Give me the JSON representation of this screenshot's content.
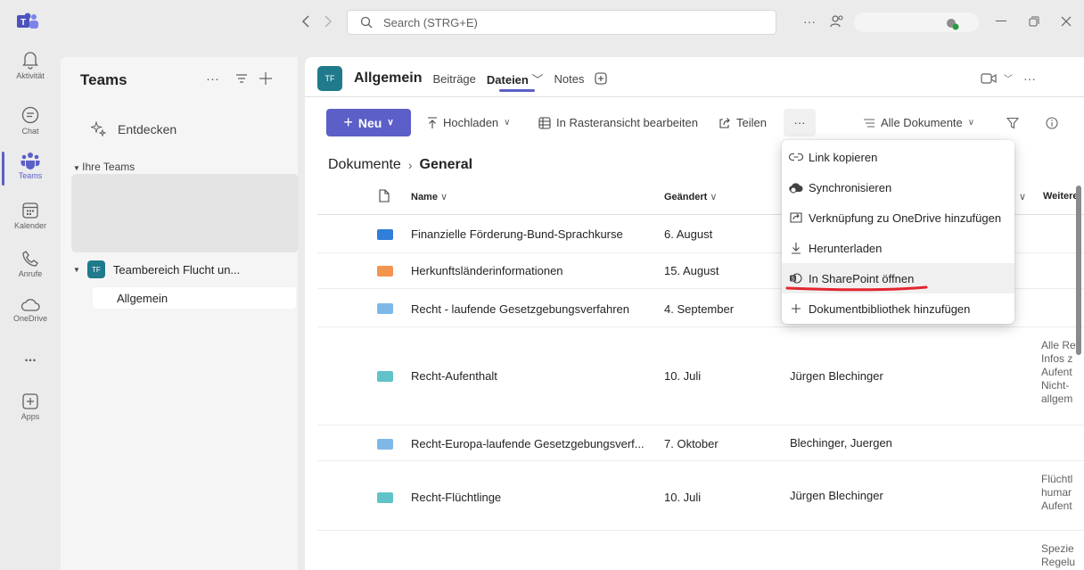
{
  "titlebar": {
    "search_placeholder": "Search (STRG+E)"
  },
  "rail": {
    "items": [
      {
        "label": "Aktivität",
        "icon": "bell-icon"
      },
      {
        "label": "Chat",
        "icon": "chat-icon"
      },
      {
        "label": "Teams",
        "icon": "teams-icon"
      },
      {
        "label": "Kalender",
        "icon": "calendar-icon"
      },
      {
        "label": "Anrufe",
        "icon": "phone-icon"
      },
      {
        "label": "OneDrive",
        "icon": "cloud-icon"
      },
      {
        "label": "Apps",
        "icon": "plus-box-icon"
      }
    ],
    "more": "..."
  },
  "teams_panel": {
    "title": "Teams",
    "discover": "Entdecken",
    "section": "Ihre Teams",
    "team_badge": "TF",
    "team_name": "Teambereich Flucht un...",
    "channel": "Allgemein"
  },
  "channel_header": {
    "badge": "TF",
    "name": "Allgemein",
    "tabs": [
      "Beiträge",
      "Dateien",
      "Notes"
    ]
  },
  "toolbar": {
    "new": "Neu",
    "upload": "Hochladen",
    "grid_edit": "In Rasteransicht bearbeiten",
    "share": "Teilen",
    "more": "···",
    "view": "Alle Dokumente"
  },
  "breadcrumb": {
    "root": "Dokumente",
    "current": "General"
  },
  "table": {
    "headers": {
      "name": "Name",
      "modified": "Geändert",
      "more": "Weitere"
    },
    "rows": [
      {
        "name": "Finanzielle Förderung-Bund-Sprachkurse",
        "modified": "6. August",
        "by": "",
        "desc": "",
        "color": "#2f7ed8"
      },
      {
        "name": "Herkunftsländerinformationen",
        "modified": "15. August",
        "by": "",
        "desc": "",
        "color": "#f3954f"
      },
      {
        "name": "Recht - laufende Gesetzgebungsverfahren",
        "modified": "4. September",
        "by": "",
        "desc": "",
        "color": "#7fb8e8"
      },
      {
        "name": "Recht-Aufenthalt",
        "modified": "10. Juli",
        "by": "Jürgen Blechinger",
        "desc": "Alle Re\nInfos z\nAufent\nNicht-\nallgem",
        "color": "#62c2c9"
      },
      {
        "name": "Recht-Europa-laufende Gesetzgebungsverf...",
        "modified": "7. Oktober",
        "by": "Blechinger, Juergen",
        "desc": "",
        "color": "#7fb8e8"
      },
      {
        "name": "Recht-Flüchtlinge",
        "modified": "10. Juli",
        "by": "Jürgen Blechinger",
        "desc": "Flüchtl\nhumar\nAufent",
        "color": "#62c2c9"
      },
      {
        "name": "",
        "modified": "",
        "by": "",
        "desc": "Spezie\nRegelu",
        "color": ""
      }
    ]
  },
  "menu": {
    "items": [
      {
        "label": "Link kopieren",
        "icon": "link-icon"
      },
      {
        "label": "Synchronisieren",
        "icon": "sync-icon"
      },
      {
        "label": "Verknüpfung zu OneDrive hinzufügen",
        "icon": "shortcut-icon"
      },
      {
        "label": "Herunterladen",
        "icon": "download-icon"
      },
      {
        "label": "In SharePoint öffnen",
        "icon": "sharepoint-icon"
      },
      {
        "label": "Dokumentbibliothek hinzufügen",
        "icon": "plus-icon"
      }
    ]
  },
  "colors": {
    "accent": "#5b5fc7",
    "team_badge": "#1f7a8c",
    "annotation": "#e3262f"
  }
}
